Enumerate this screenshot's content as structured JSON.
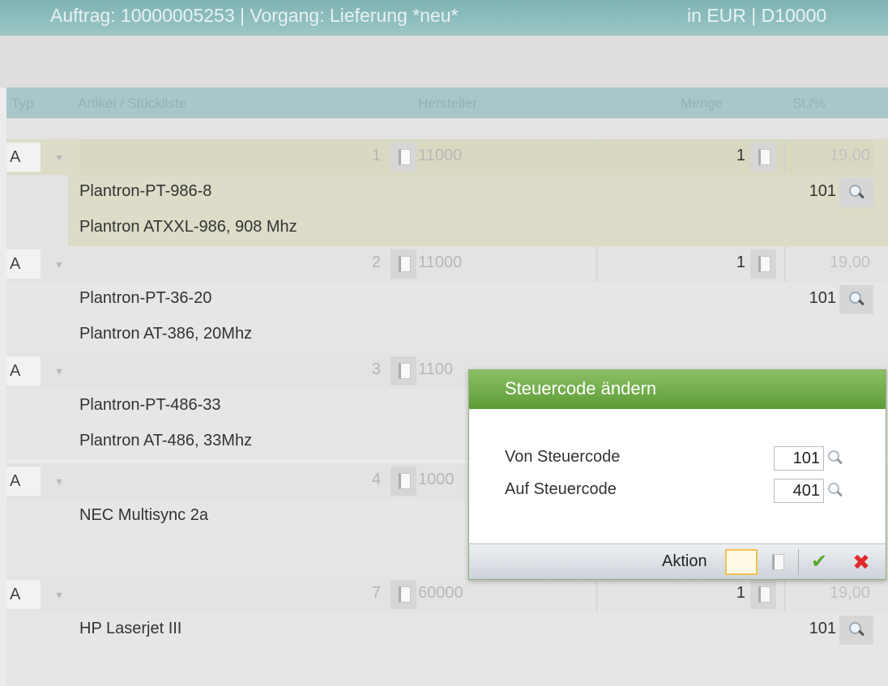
{
  "header": {
    "title": "Auftrag: 10000005253 | Vorgang: Lieferung *neu*",
    "currency": "in EUR |",
    "customer": "D10000"
  },
  "columns": {
    "typ": "Typ",
    "artikel": "Artikel / Stückliste",
    "hersteller": "Hersteller",
    "menge": "Menge",
    "st": "St./%"
  },
  "items": [
    {
      "typ": "A",
      "pos": "1",
      "hersteller": "11000",
      "menge": "1",
      "st": "19,00",
      "article": "Plantron-PT-986-8",
      "code": "101",
      "desc": "Plantron ATXXL-986, 908 Mhz"
    },
    {
      "typ": "A",
      "pos": "2",
      "hersteller": "11000",
      "menge": "1",
      "st": "19,00",
      "article": "Plantron-PT-36-20",
      "code": "101",
      "desc": "Plantron AT-386, 20Mhz"
    },
    {
      "typ": "A",
      "pos": "3",
      "hersteller": "1100",
      "menge": "",
      "st": "",
      "article": "Plantron-PT-486-33",
      "code": "",
      "desc": "Plantron AT-486, 33Mhz"
    },
    {
      "typ": "A",
      "pos": "4",
      "hersteller": "1000",
      "menge": "",
      "st": "",
      "article": "NEC Multisync 2a",
      "code": "",
      "desc": ""
    },
    {
      "typ": "A",
      "pos": "7",
      "hersteller": "60000",
      "menge": "1",
      "st": "19,00",
      "article": "HP Laserjet III",
      "code": "101",
      "desc": ""
    }
  ],
  "dialog": {
    "title": "Steuercode ändern",
    "from_label": "Von Steuercode",
    "from_value": "101",
    "to_label": "Auf Steuercode",
    "to_value": "401",
    "action_label": "Aktion",
    "ok_glyph": "✔",
    "cancel_glyph": "✖"
  }
}
